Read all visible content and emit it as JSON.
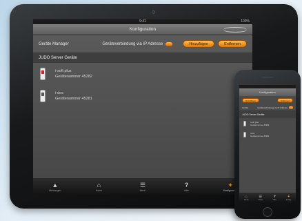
{
  "ipad": {
    "status_bar": {
      "time": "9:41",
      "battery": "100%"
    },
    "nav_title": "Konfiguration",
    "manager_row": {
      "label": "Geräte Manager",
      "link_text": "Geräteverbindung via IP Adresse",
      "add_button": "Hinzufügen",
      "delete_button": "Entfernen"
    },
    "section_title": "JUDO Server Geräte",
    "devices": [
      {
        "name": "i-soft plus",
        "serial": "Gerätenummer 45282"
      },
      {
        "name": "i-dos",
        "serial": "Gerätenummer 45281"
      }
    ],
    "tabs": [
      {
        "label": "Meldungen",
        "icon": "warning-icon"
      },
      {
        "label": "Home",
        "icon": "home-icon"
      },
      {
        "label": "Menü",
        "icon": "menu-icon"
      },
      {
        "label": "Hilfe",
        "icon": "help-icon"
      },
      {
        "label": "Konfiguration",
        "icon": "wrench-icon"
      }
    ],
    "active_tab": "Konfiguration"
  },
  "iphone": {
    "nav_title": "Konfiguration",
    "buttons": {
      "add": "Hinzufügen",
      "delete": "Entfernen"
    },
    "row_label": "Geräte",
    "row_link": "Geräteverbindung via IP Adresse",
    "section_title": "JUDO Server Geräte",
    "devices": [
      {
        "name": "i-soft plus",
        "serial": "Gerätenummer 45282"
      },
      {
        "name": "i-dos",
        "serial": "Gerätenummer 45281"
      }
    ],
    "tabs": [
      {
        "label": "Home"
      },
      {
        "label": "Menü"
      },
      {
        "label": "Hilfe"
      },
      {
        "label": "Konfig."
      }
    ]
  },
  "colors": {
    "accent": "#f0900a",
    "button_gradient_top": "#ffbb60",
    "screen_background": "#4a4a4a",
    "tabbar": "#1a1a1a",
    "page_background": "#d9e7f1"
  }
}
